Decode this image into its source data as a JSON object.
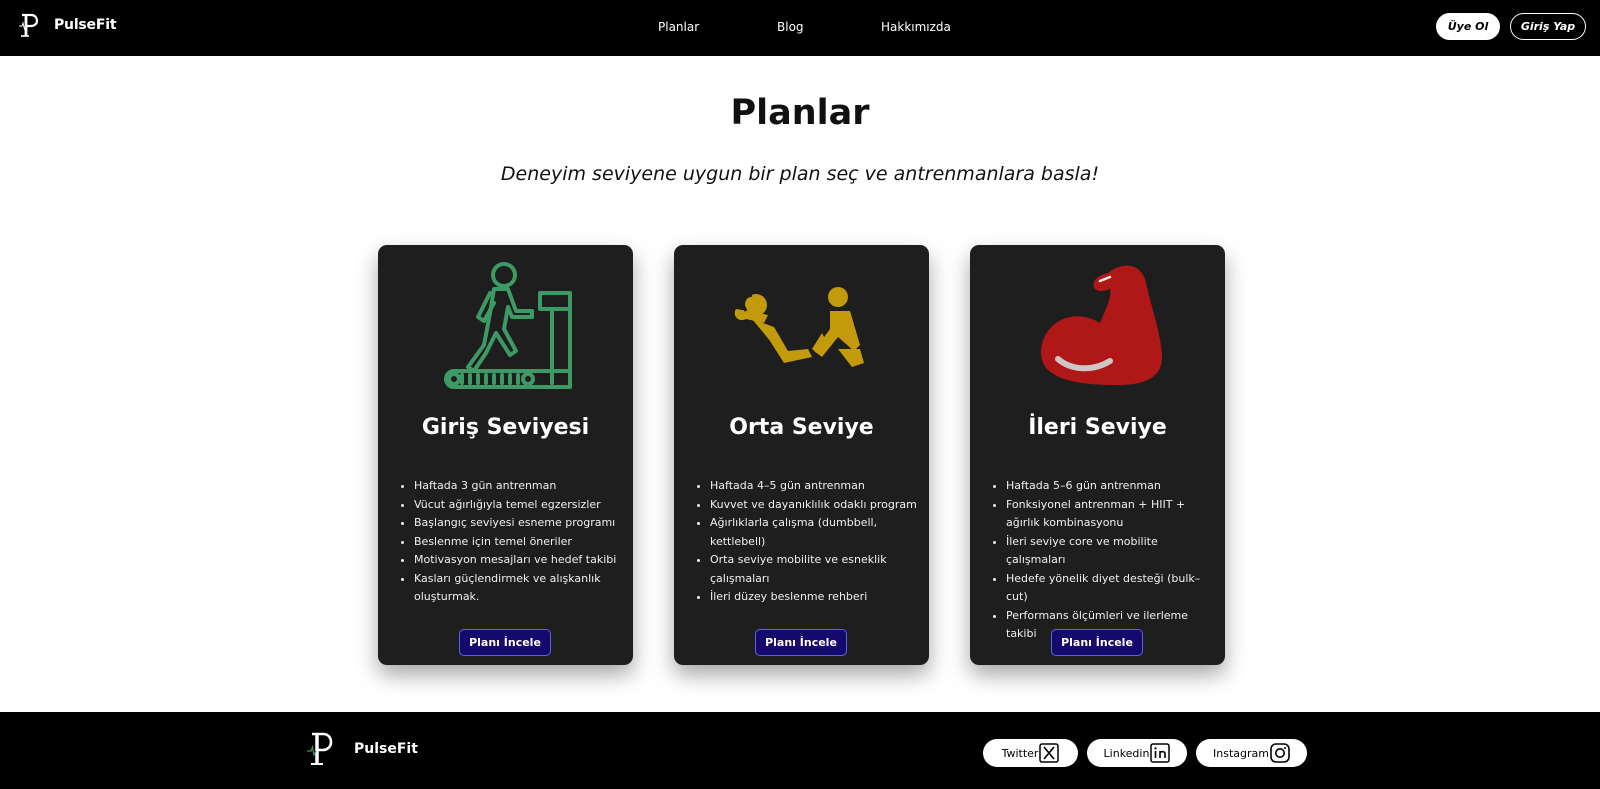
{
  "navbar": {
    "brand": "PulseFit",
    "links": [
      "Planlar",
      "Blog",
      "Hakkımızda"
    ],
    "signup_label": "Üye Ol",
    "login_label": "Giriş Yap"
  },
  "hero": {
    "title": "Planlar",
    "subtitle": "Deneyim seviyene uygun bir plan seç ve antrenmanlara basla!"
  },
  "plans": [
    {
      "title": "Giriş Seviyesi",
      "icon": "treadmill-icon",
      "icon_color": "#3d9a65",
      "features": [
        "Haftada 3 gün antrenman",
        "Vücut ağırlığıyla temel egzersizler",
        "Başlangıç seviyesi esneme programı",
        "Beslenme için temel öneriler",
        "Motivasyon mesajları ve hedef takibi",
        "Kasları güçlendirmek ve alışkanlık oluşturmak."
      ],
      "button_label": "Planı İncele"
    },
    {
      "title": "Orta Seviye",
      "icon": "partner-situps-icon",
      "icon_color": "#c39a0b",
      "features": [
        "Haftada 4–5 gün antrenman",
        "Kuvvet ve dayanıklılık odaklı program",
        "Ağırlıklarla çalışma (dumbbell, kettlebell)",
        "Orta seviye mobilite ve esneklik çalışmaları",
        "İleri düzey beslenme rehberi"
      ],
      "button_label": "Planı İncele"
    },
    {
      "title": "İleri Seviye",
      "icon": "flexed-arm-icon",
      "icon_color": "#b01818",
      "features": [
        "Haftada 5–6 gün antrenman",
        "Fonksiyonel antrenman + HIIT + ağırlık kombinasyonu",
        "İleri seviye core ve mobilite çalışmaları",
        "Hedefe yönelik diyet desteği (bulk–cut)",
        "Performans ölçümleri ve ilerleme takibi"
      ],
      "button_label": "Planı İncele"
    }
  ],
  "footer": {
    "brand": "PulseFit",
    "socials": [
      {
        "label": "Twitter",
        "icon": "x-logo-icon"
      },
      {
        "label": "Linkedin",
        "icon": "linkedin-icon"
      },
      {
        "label": "Instagram",
        "icon": "instagram-icon"
      }
    ]
  },
  "colors": {
    "nav_bg": "#000000",
    "card_bg": "#1e1e1e",
    "button_bg": "#17086e",
    "button_border": "#5a64d8"
  }
}
